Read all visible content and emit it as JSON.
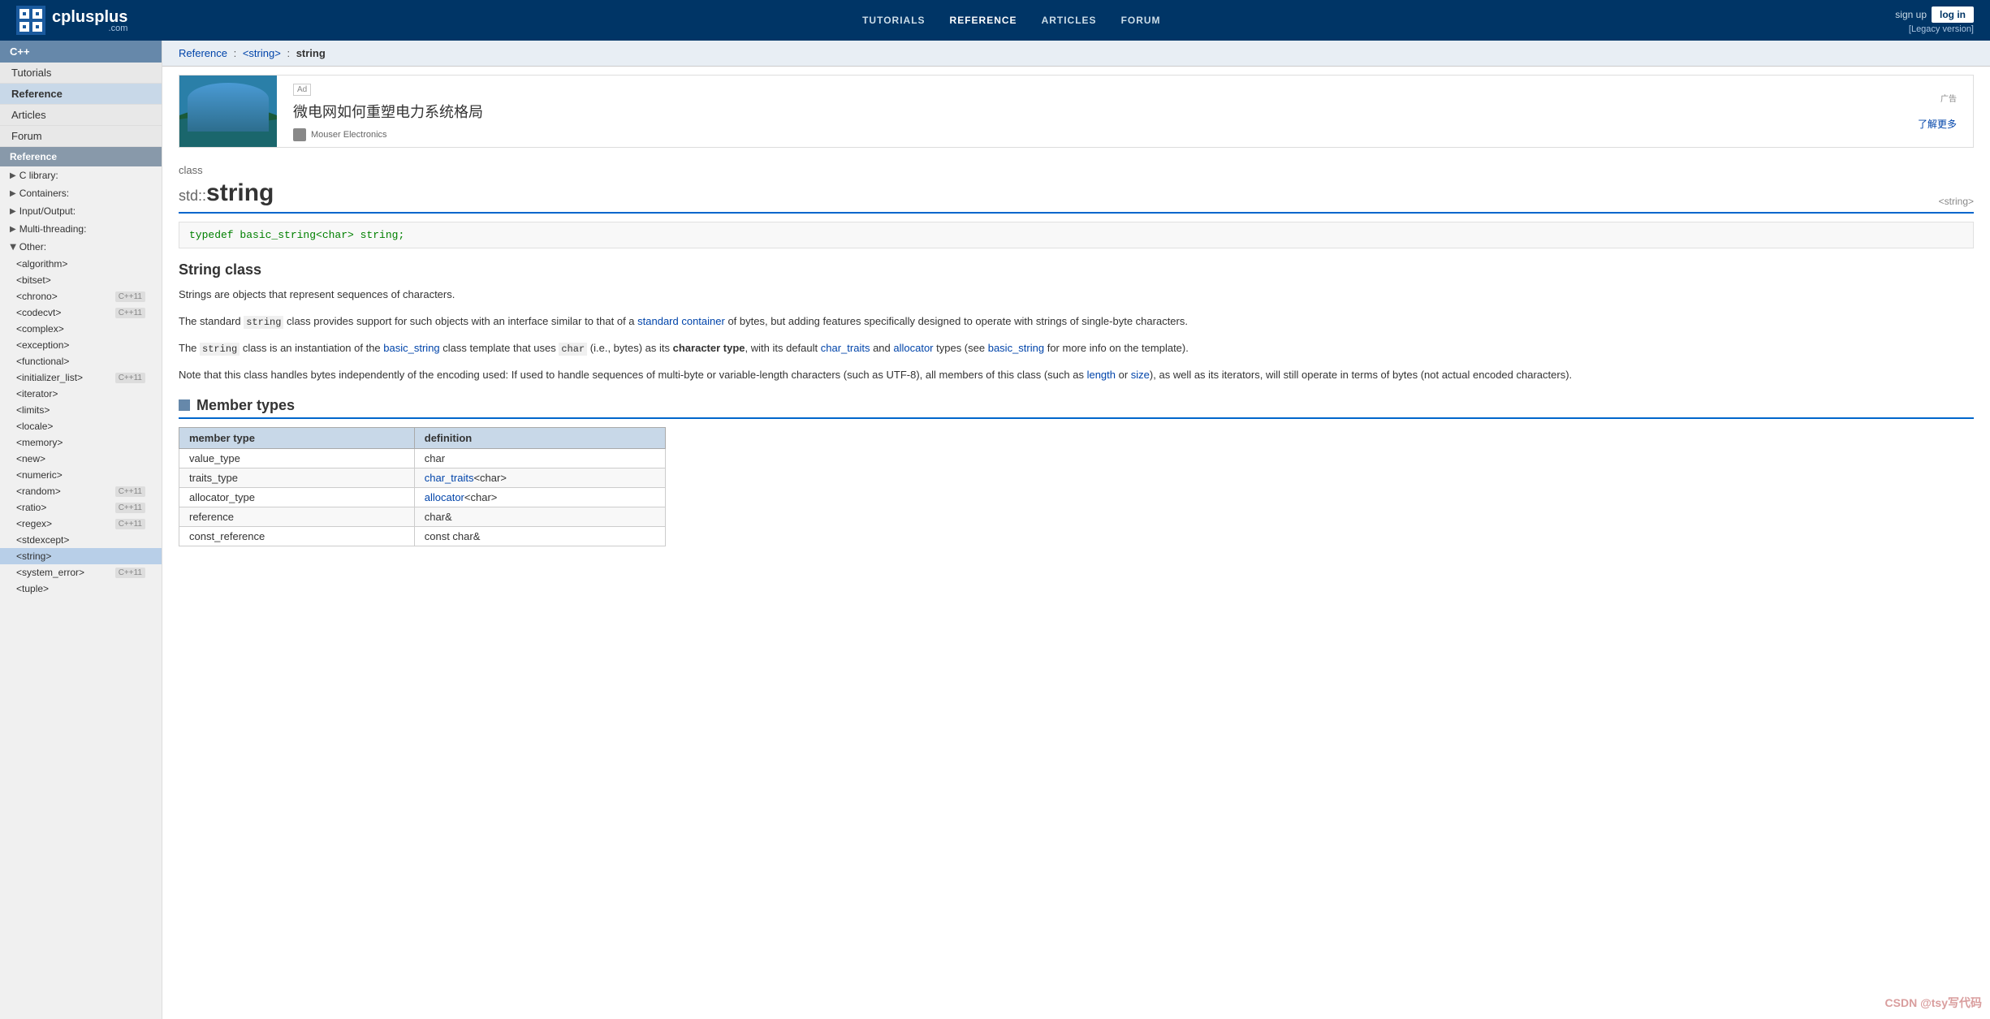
{
  "header": {
    "logo_text": "cplusplus",
    "logo_com": ".com",
    "nav": [
      "TUTORIALS",
      "REFERENCE",
      "ARTICLES",
      "FORUM"
    ],
    "active_nav": "REFERENCE",
    "sign_up": "sign up",
    "log_in": "log in",
    "legacy": "[Legacy version]"
  },
  "sidebar": {
    "cpp_label": "C++",
    "main_items": [
      {
        "label": "Tutorials",
        "active": false
      },
      {
        "label": "Reference",
        "active": true
      },
      {
        "label": "Articles",
        "active": false
      },
      {
        "label": "Forum",
        "active": false
      }
    ],
    "ref_label": "Reference",
    "sections": [
      {
        "label": "C library:",
        "expanded": false,
        "arrow": "▶"
      },
      {
        "label": "Containers:",
        "expanded": false,
        "arrow": "▶"
      },
      {
        "label": "Input/Output:",
        "expanded": false,
        "arrow": "▶"
      },
      {
        "label": "Multi-threading:",
        "expanded": false,
        "arrow": "▶"
      },
      {
        "label": "Other:",
        "expanded": true,
        "arrow": "▼"
      }
    ],
    "other_items": [
      {
        "label": "<algorithm>",
        "badge": "",
        "active": false
      },
      {
        "label": "<bitset>",
        "badge": "",
        "active": false
      },
      {
        "label": "<chrono>",
        "badge": "C++11",
        "active": false
      },
      {
        "label": "<codecvt>",
        "badge": "C++11",
        "active": false
      },
      {
        "label": "<complex>",
        "badge": "",
        "active": false
      },
      {
        "label": "<exception>",
        "badge": "",
        "active": false
      },
      {
        "label": "<functional>",
        "badge": "",
        "active": false
      },
      {
        "label": "<initializer_list>",
        "badge": "C++11",
        "active": false
      },
      {
        "label": "<iterator>",
        "badge": "",
        "active": false
      },
      {
        "label": "<limits>",
        "badge": "",
        "active": false
      },
      {
        "label": "<locale>",
        "badge": "",
        "active": false
      },
      {
        "label": "<memory>",
        "badge": "",
        "active": false
      },
      {
        "label": "<new>",
        "badge": "",
        "active": false
      },
      {
        "label": "<numeric>",
        "badge": "",
        "active": false
      },
      {
        "label": "<random>",
        "badge": "C++11",
        "active": false
      },
      {
        "label": "<ratio>",
        "badge": "C++11",
        "active": false
      },
      {
        "label": "<regex>",
        "badge": "C++11",
        "active": false
      },
      {
        "label": "<stdexcept>",
        "badge": "",
        "active": false
      },
      {
        "label": "<string>",
        "badge": "",
        "active": true
      },
      {
        "label": "<system_error>",
        "badge": "C++11",
        "active": false
      },
      {
        "label": "<tuple>",
        "badge": "",
        "active": false
      }
    ]
  },
  "breadcrumb": {
    "items": [
      "Reference",
      "<string>",
      "string"
    ],
    "links": [
      true,
      true,
      false
    ]
  },
  "ad": {
    "label": "Ad",
    "title": "微电网如何重塑电力系统格局",
    "brand": "Mouser Electronics",
    "corner": "广告",
    "learn_more": "了解更多"
  },
  "page": {
    "class_label": "class",
    "title_prefix": "std::",
    "title": "string",
    "header_ref": "<string>",
    "typedef": "typedef basic_string<char> string;",
    "section_title": "String class",
    "para1": "Strings are objects that represent sequences of characters.",
    "para2_before": "The standard ",
    "para2_code": "string",
    "para2_after": " class provides support for such objects with an interface similar to that of a ",
    "para2_link": "standard container",
    "para2_end": " of bytes, but adding features specifically designed to operate with strings of single-byte characters.",
    "para3_before": "The ",
    "para3_code1": "string",
    "para3_mid1": " class is an instantiation of the ",
    "para3_link1": "basic_string",
    "para3_mid2": " class template that uses ",
    "para3_code2": "char",
    "para3_mid3": " (i.e., bytes) as its ",
    "para3_bold": "character type",
    "para3_mid4": ", with its default ",
    "para3_link2": "char_traits",
    "para3_mid5": " and ",
    "para3_link3": "allocator",
    "para3_mid6": " types (see ",
    "para3_link4": "basic_string",
    "para3_end": " for more info on the template).",
    "para4": "Note that this class handles bytes independently of the encoding used: If used to handle sequences of multi-byte or variable-length characters (such as UTF-8), all members of this class (such as ",
    "para4_link1": "length",
    "para4_mid": " or ",
    "para4_link2": "size",
    "para4_end": "), as well as its iterators, will still operate in terms of bytes (not actual encoded characters).",
    "member_types_title": "Member types",
    "table_headers": [
      "member type",
      "definition"
    ],
    "table_rows": [
      {
        "type": "value_type",
        "def": "char",
        "def_link": false
      },
      {
        "type": "traits_type",
        "def": "char_traits<char>",
        "def_link": true,
        "def_link_text": "char_traits",
        "def_suffix": "<char>"
      },
      {
        "type": "allocator_type",
        "def": "allocator<char>",
        "def_link": true,
        "def_link_text": "allocator",
        "def_suffix": "<char>"
      },
      {
        "type": "reference",
        "def": "char&",
        "def_link": false
      },
      {
        "type": "const_reference",
        "def": "const_char&",
        "def_link": false
      }
    ]
  },
  "watermark": "CSDN @tsy写代码"
}
